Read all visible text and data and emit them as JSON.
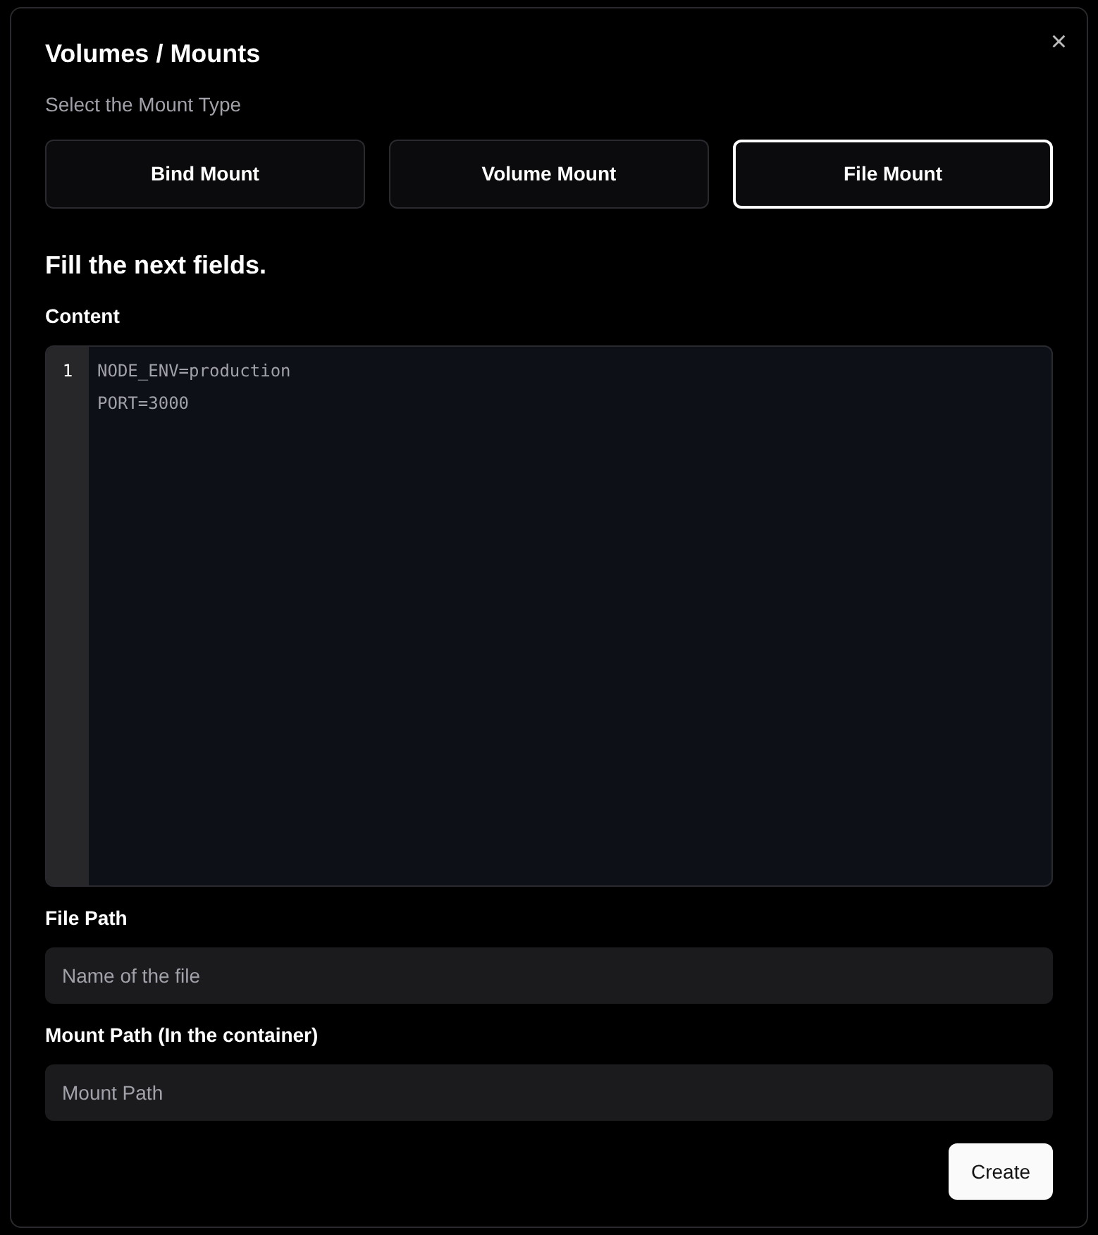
{
  "dialog": {
    "title": "Volumes / Mounts",
    "close": "×"
  },
  "mount_type": {
    "label": "Select the Mount Type",
    "options": [
      {
        "label": "Bind Mount",
        "selected": false
      },
      {
        "label": "Volume Mount",
        "selected": false
      },
      {
        "label": "File Mount",
        "selected": true
      }
    ]
  },
  "section_heading": "Fill the next fields.",
  "content": {
    "label": "Content",
    "line_numbers": [
      "1"
    ],
    "lines": [
      "NODE_ENV=production",
      "PORT=3000"
    ]
  },
  "fields": [
    {
      "label": "File Path",
      "placeholder": "Name of the file"
    },
    {
      "label": "Mount Path (In the container)",
      "placeholder": "Mount Path"
    }
  ],
  "submit": "Create"
}
